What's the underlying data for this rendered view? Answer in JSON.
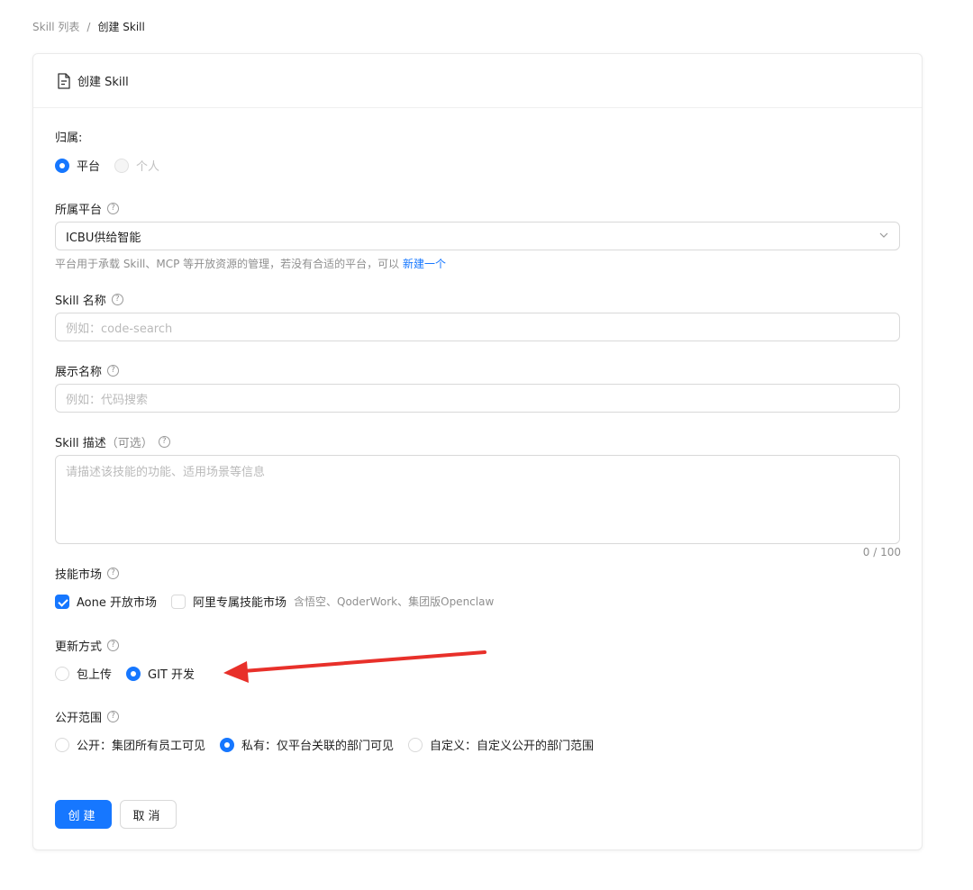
{
  "breadcrumb": {
    "parent": "Skill 列表",
    "separator": "/",
    "current": "创建 Skill"
  },
  "card": {
    "title": "创建 Skill",
    "title_icon": "file-text-icon"
  },
  "form": {
    "ownership": {
      "label": "归属:",
      "options": [
        {
          "label": "平台",
          "checked": true,
          "disabled": false
        },
        {
          "label": "个人",
          "checked": false,
          "disabled": true
        }
      ]
    },
    "platform": {
      "label": "所属平台",
      "value": "ICBU供给智能",
      "hint_text": "平台用于承载 Skill、MCP 等开放资源的管理，若没有合适的平台，可以",
      "hint_link": "新建一个"
    },
    "skill_name": {
      "label": "Skill 名称",
      "placeholder": "例如：code-search"
    },
    "display_name": {
      "label": "展示名称",
      "placeholder": "例如：代码搜索"
    },
    "description": {
      "label": "Skill 描述",
      "optional": "（可选）",
      "placeholder": "请描述该技能的功能、适用场景等信息",
      "counter": "0 / 100"
    },
    "market": {
      "label": "技能市场",
      "options": [
        {
          "label": "Aone 开放市场",
          "checked": true
        },
        {
          "label": "阿里专属技能市场",
          "checked": false,
          "note": "含悟空、QoderWork、集团版Openclaw"
        }
      ]
    },
    "update_mode": {
      "label": "更新方式",
      "options": [
        {
          "label": "包上传",
          "checked": false
        },
        {
          "label": "GIT 开发",
          "checked": true
        }
      ]
    },
    "visibility": {
      "label": "公开范围",
      "options": [
        {
          "label": "公开：集团所有员工可见",
          "checked": false
        },
        {
          "label": "私有：仅平台关联的部门可见",
          "checked": true
        },
        {
          "label": "自定义：自定义公开的部门范围",
          "checked": false
        }
      ]
    }
  },
  "actions": {
    "create": "创建",
    "cancel": "取消"
  },
  "colors": {
    "primary": "#1677ff",
    "annotation_arrow": "#e8302a"
  }
}
